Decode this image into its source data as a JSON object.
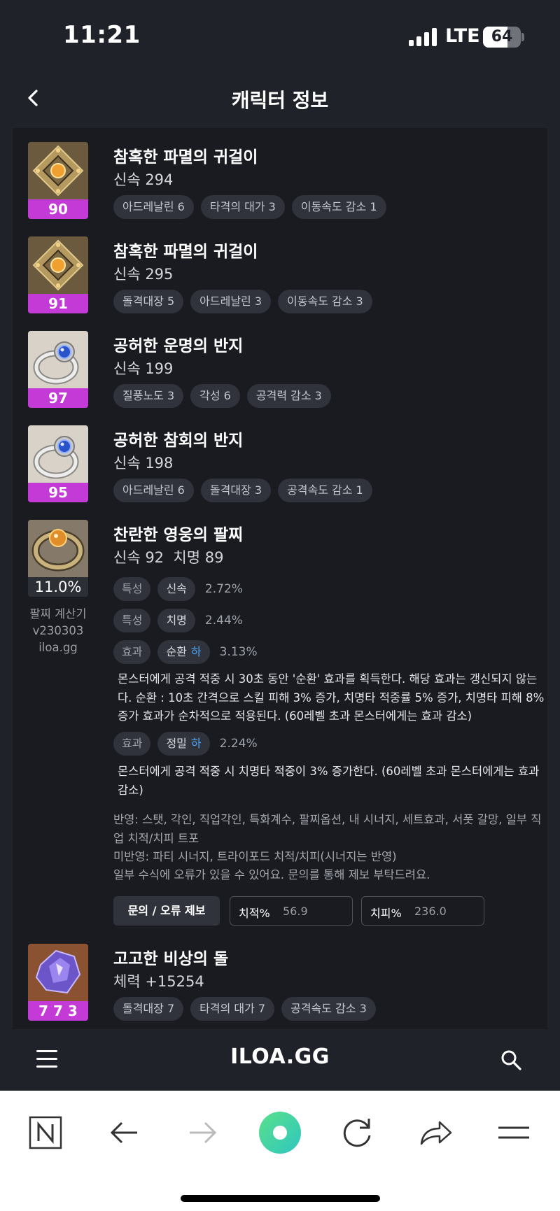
{
  "status_bar": {
    "time": "11:21",
    "network": "LTE",
    "battery": "64",
    "battery_level": 0.64
  },
  "header": {
    "title": "캐릭터 정보"
  },
  "items": [
    {
      "name": "참혹한 파멸의 귀걸이",
      "stat": "신속 294",
      "badge": "90",
      "icon": "earring-icon",
      "tags": [
        "아드레날린 6",
        "타격의 대가 3",
        "이동속도 감소 1"
      ]
    },
    {
      "name": "참혹한 파멸의 귀걸이",
      "stat": "신속 295",
      "badge": "91",
      "icon": "earring-icon",
      "tags": [
        "돌격대장 5",
        "아드레날린 3",
        "이동속도 감소 3"
      ]
    },
    {
      "name": "공허한 운명의 반지",
      "stat": "신속 199",
      "badge": "97",
      "icon": "ring-icon",
      "tags": [
        "질풍노도 3",
        "각성 6",
        "공격력 감소 3"
      ]
    },
    {
      "name": "공허한 참회의 반지",
      "stat": "신속 198",
      "badge": "95",
      "icon": "ring-icon",
      "tags": [
        "아드레날린 6",
        "돌격대장 3",
        "공격속도 감소 1"
      ]
    }
  ],
  "bracelet": {
    "name": "찬란한 영웅의 팔찌",
    "stat": "신속 92  치명 89",
    "badge": "11.0%",
    "calc_label": [
      "팔찌 계산기",
      "v230303",
      "iloa.gg"
    ],
    "options": [
      {
        "type": "특성",
        "name": "신속",
        "grade": "",
        "value": "2.72%"
      },
      {
        "type": "특성",
        "name": "치명",
        "grade": "",
        "value": "2.44%"
      },
      {
        "type": "효과",
        "name": "순환",
        "grade": "하",
        "value": "3.13%",
        "desc": "몬스터에게 공격 적중 시 30초 동안 '순환' 효과를 획득한다. 해당 효과는 갱신되지 않는다. 순환 : 10초 간격으로 스킬 피해 3% 증가, 치명타 적중률 5% 증가, 치명타 피해 8% 증가 효과가 순차적으로 적용된다. (60레벨 초과 몬스터에게는 효과 감소)"
      },
      {
        "type": "효과",
        "name": "정밀",
        "grade": "하",
        "value": "2.24%",
        "desc": "몬스터에게 공격 적중 시 치명타 적중이 3% 증가한다. (60레벨 초과 몬스터에게는 효과 감소)"
      }
    ],
    "notes": [
      "반영: 스탯, 각인, 직업각인, 특화계수, 팔찌옵션, 내 시너지, 세트효과, 서폿 갈망, 일부 직업 치적/치피 트포",
      "미반영: 파티 시너지, 트라이포드 치적/치피(시너지는 반영)",
      "일부 수식에 오류가 있을 수 있어요. 문의를 통해 제보 부탁드려요."
    ],
    "report_button": "문의 / 오류 제보",
    "crit_rate_label": "치적%",
    "crit_rate_value": "56.9",
    "crit_dmg_label": "치피%",
    "crit_dmg_value": "236.0"
  },
  "stone": {
    "name": "고고한 비상의 돌",
    "stat": "체력 +15254",
    "badge": "7 7 3",
    "icon": "ability-stone-icon",
    "tags": [
      "돌격대장 7",
      "타격의 대가 7",
      "공격속도 감소 3"
    ]
  },
  "appbar": {
    "logo": "ILOA.GG"
  },
  "colors": {
    "background": "#1f2229",
    "panel": "#191b21",
    "badge": "#c43ad6",
    "grade": "#4aa3f5",
    "chip": "#30333b"
  }
}
